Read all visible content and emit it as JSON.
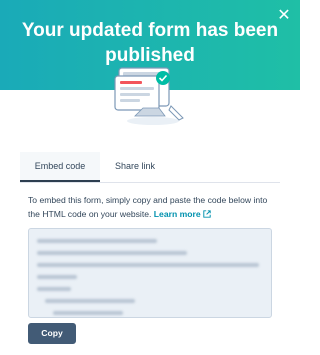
{
  "modal": {
    "title": "Your updated form has been published",
    "close_icon": "close-icon"
  },
  "illustration": {
    "icon": "published-form-illustration"
  },
  "tabs": [
    {
      "label": "Embed code",
      "active": true
    },
    {
      "label": "Share link",
      "active": false
    }
  ],
  "embed": {
    "description": "To embed this form, simply copy and paste the code below into the HTML code on your website.",
    "learn_more_label": "Learn more",
    "learn_more_icon": "external-link-icon",
    "code_state": "blurred"
  },
  "copy_button": {
    "label": "Copy"
  },
  "colors": {
    "header_start": "#1aaab8",
    "header_end": "#1fbfa6",
    "link": "#0091ae",
    "primary_button": "#425b76",
    "text": "#33475b"
  }
}
